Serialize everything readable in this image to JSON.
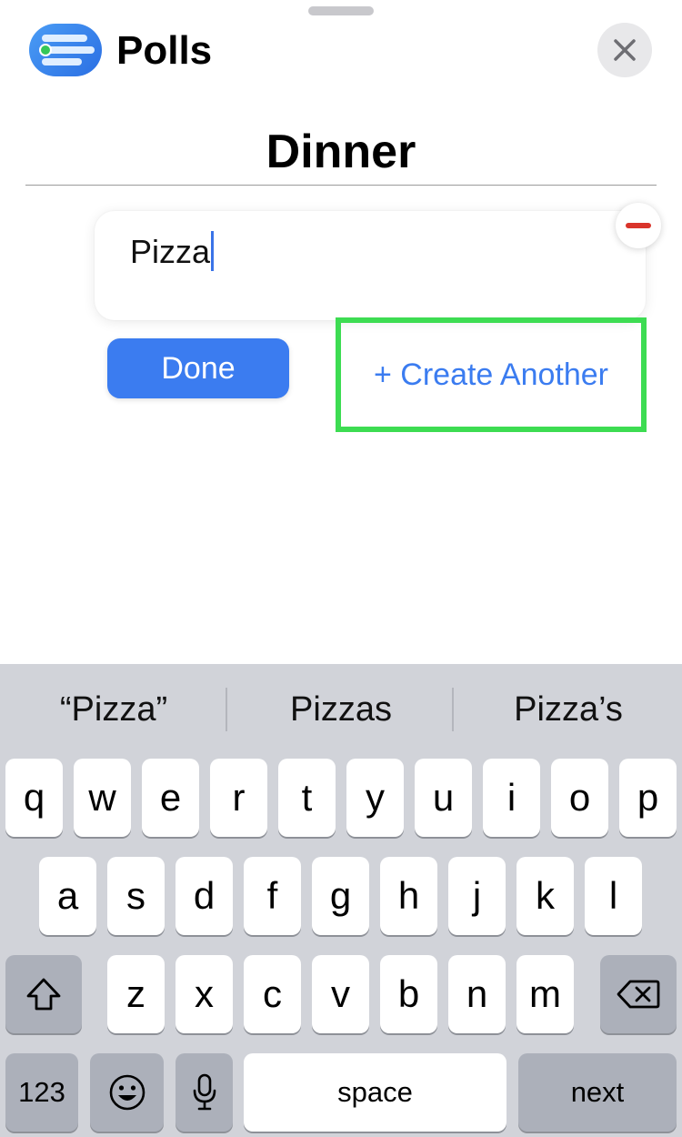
{
  "header": {
    "app_name": "Polls",
    "app_icon": "polls-list-icon",
    "close_icon": "close-icon"
  },
  "poll": {
    "title": "Dinner",
    "options": [
      {
        "text": "Pizza",
        "remove_icon": "minus-circle-icon"
      }
    ]
  },
  "actions": {
    "done_label": "Done",
    "create_another_label": "+ Create Another",
    "highlight_color": "#3ddc52"
  },
  "keyboard": {
    "suggestions": [
      "“Pizza”",
      "Pizzas",
      "Pizza’s"
    ],
    "row1": [
      "q",
      "w",
      "e",
      "r",
      "t",
      "y",
      "u",
      "i",
      "o",
      "p"
    ],
    "row2": [
      "a",
      "s",
      "d",
      "f",
      "g",
      "h",
      "j",
      "k",
      "l"
    ],
    "row3": [
      "z",
      "x",
      "c",
      "v",
      "b",
      "n",
      "m"
    ],
    "shift_icon": "shift-icon",
    "backspace_icon": "backspace-icon",
    "numbers_label": "123",
    "emoji_icon": "emoji-icon",
    "mic_icon": "microphone-icon",
    "space_label": "space",
    "return_label": "next"
  },
  "colors": {
    "accent": "#3b7cf0",
    "remove": "#d9342b",
    "keyboard_bg": "#d1d3d9"
  }
}
